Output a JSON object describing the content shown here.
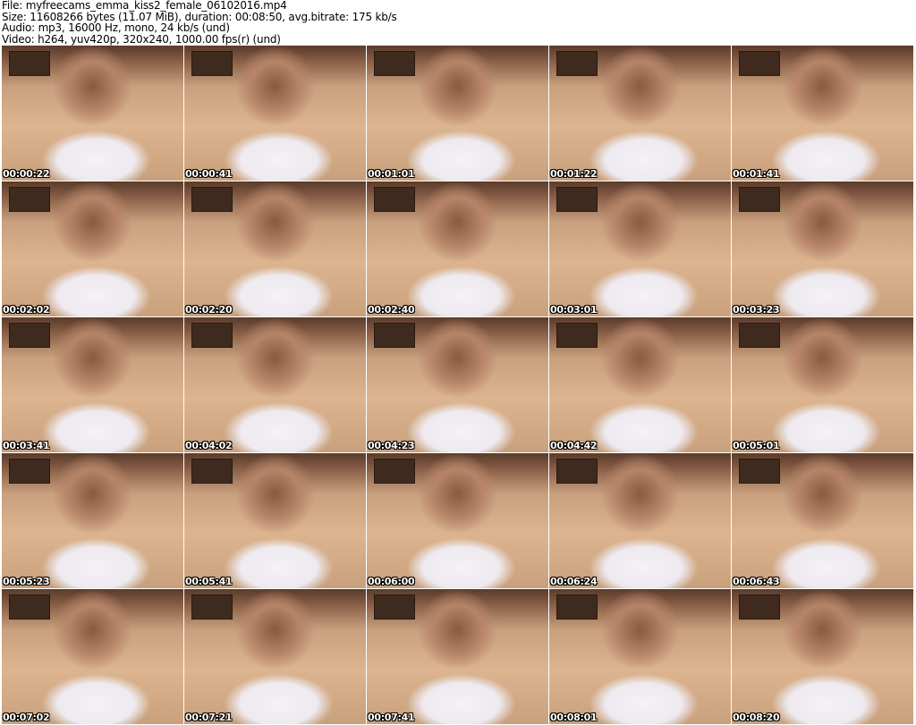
{
  "header": {
    "file": "File: myfreecams_emma_kiss2_female_06102016.mp4",
    "size": "Size: 11608266 bytes (11.07 MiB), duration: 00:08:50, avg.bitrate: 175 kb/s",
    "audio": "Audio: mp3, 16000 Hz, mono, 24 kb/s (und)",
    "video": "Video: h264, yuv420p, 320x240, 1000.00 fps(r) (und)"
  },
  "thumbnails": [
    "00:00:22",
    "00:00:41",
    "00:01:01",
    "00:01:22",
    "00:01:41",
    "00:02:02",
    "00:02:20",
    "00:02:40",
    "00:03:01",
    "00:03:23",
    "00:03:41",
    "00:04:02",
    "00:04:23",
    "00:04:42",
    "00:05:01",
    "00:05:23",
    "00:05:41",
    "00:06:00",
    "00:06:24",
    "00:06:43",
    "00:07:02",
    "00:07:21",
    "00:07:41",
    "00:08:01",
    "00:08:20"
  ]
}
